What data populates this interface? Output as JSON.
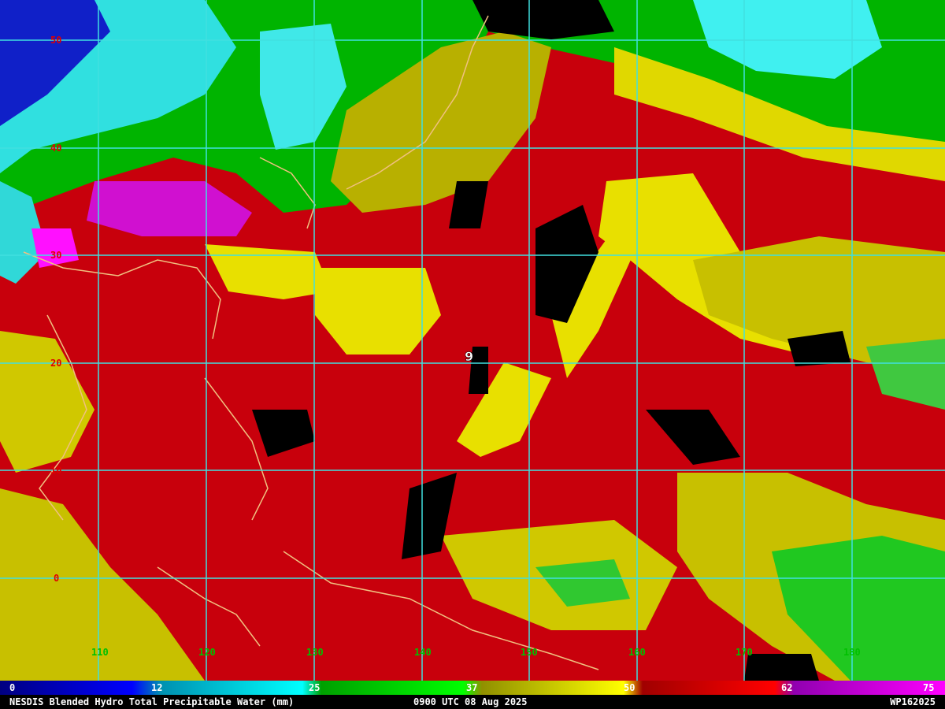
{
  "product": {
    "title": "NESDIS Blended Hydro Total Precipitable Water (mm)",
    "time": "0900 UTC 08 Aug 2025",
    "storm_id": "WP162025",
    "storm_marker": "9"
  },
  "colorbar": {
    "ticks": [
      {
        "value": 0,
        "label": "0"
      },
      {
        "value": 12,
        "label": "12"
      },
      {
        "value": 25,
        "label": "25"
      },
      {
        "value": 37,
        "label": "37"
      },
      {
        "value": 50,
        "label": "50"
      },
      {
        "value": 62,
        "label": "62"
      },
      {
        "value": 75,
        "label": "75"
      }
    ],
    "range": [
      0,
      75
    ],
    "colors": [
      "#000080",
      "#0000ff",
      "#00a0c8",
      "#00ffff",
      "#00c000",
      "#00ff00",
      "#a0a000",
      "#ffff00",
      "#c00000",
      "#ff0000",
      "#a000c0",
      "#ff00ff"
    ]
  },
  "latitudes": [
    {
      "label": "50"
    },
    {
      "label": "40"
    },
    {
      "label": "30"
    },
    {
      "label": "20"
    },
    {
      "label": "10"
    },
    {
      "label": "0"
    }
  ],
  "longitudes": [
    {
      "label": "110"
    },
    {
      "label": "120"
    },
    {
      "label": "130"
    },
    {
      "label": "140"
    },
    {
      "label": "150"
    },
    {
      "label": "160"
    },
    {
      "label": "170"
    },
    {
      "label": "180"
    }
  ],
  "palette": {
    "background_moist": "#cc0010",
    "yellow": "#e8e000",
    "olive": "#a8a000",
    "green": "#00c000",
    "cyan": "#00e0e8",
    "blue": "#0010c0",
    "magenta": "#e010e0",
    "black": "#000000",
    "grid": "#40e0e0",
    "coast": "#f0c080"
  }
}
